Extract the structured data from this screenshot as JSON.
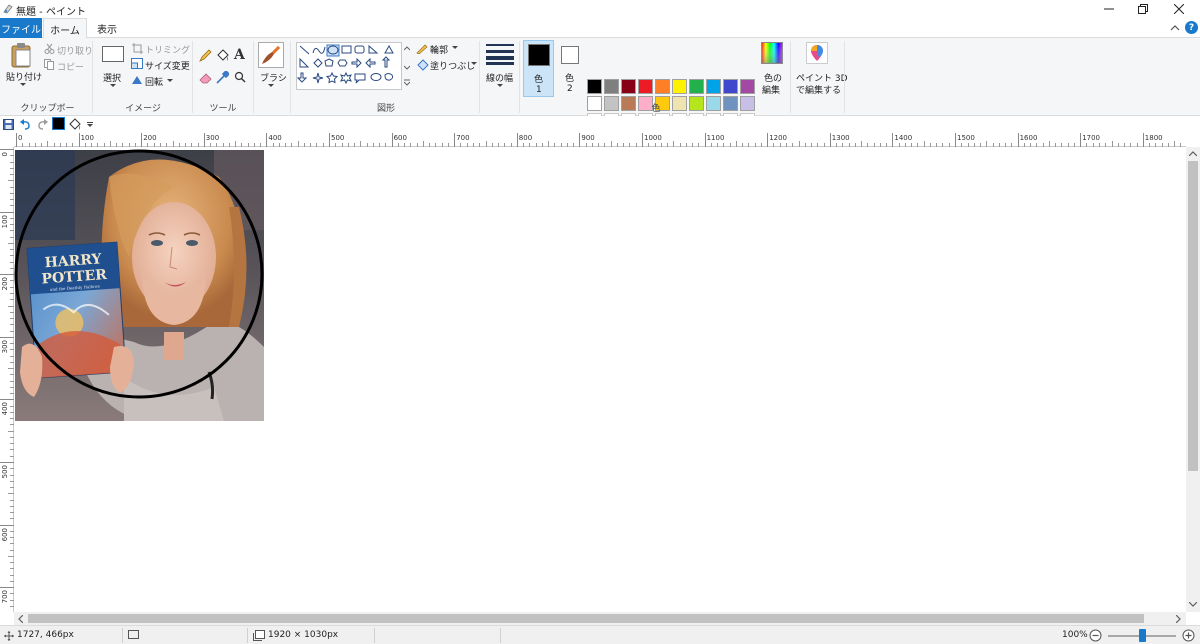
{
  "window": {
    "title": "無題 - ペイント"
  },
  "tabs": {
    "file": "ファイル",
    "home": "ホーム",
    "view": "表示"
  },
  "ribbon": {
    "clipboard": {
      "paste": "貼り付け",
      "cut": "切り取り",
      "copy": "コピー",
      "label": "クリップボード"
    },
    "image": {
      "select": "選択",
      "crop": "トリミング",
      "resize": "サイズ変更",
      "rotate": "回転",
      "label": "イメージ"
    },
    "tools": {
      "label": "ツール"
    },
    "brushes": {
      "label": "ブラシ"
    },
    "shapes": {
      "outline": "輪郭",
      "fill": "塗りつぶし",
      "label": "図形"
    },
    "size": {
      "label": "線の幅"
    },
    "colors": {
      "color1": "色",
      "color1_num": "1",
      "color2": "色",
      "color2_num": "2",
      "edit_colors_l1": "色の",
      "edit_colors_l2": "編集",
      "label": "色",
      "color1_value": "#000000",
      "color2_value": "#ffffff",
      "palette_row1": [
        "#000000",
        "#7f7f7f",
        "#880015",
        "#ed1c24",
        "#ff7f27",
        "#fff200",
        "#22b14c",
        "#00a2e8",
        "#3f48cc",
        "#a349a4"
      ],
      "palette_row2": [
        "#ffffff",
        "#c3c3c3",
        "#b97a57",
        "#ffaec9",
        "#ffc90e",
        "#efe4b0",
        "#b5e61d",
        "#99d9ea",
        "#7092be",
        "#c8bfe7"
      ],
      "palette_row3_count": 10
    },
    "paint3d": {
      "line1": "ペイント 3D",
      "line2": "で編集する"
    }
  },
  "ruler": {
    "h_ticks": [
      "0",
      "100",
      "200",
      "300",
      "400",
      "500",
      "600",
      "700",
      "800",
      "900",
      "1000",
      "1100",
      "1200",
      "1300",
      "1400",
      "1500",
      "1600",
      "1700",
      "1800"
    ],
    "v_ticks": [
      "0",
      "100",
      "200",
      "300",
      "400",
      "500",
      "600",
      "700"
    ]
  },
  "canvas": {
    "photo_book_line1": "HARRY",
    "photo_book_line2": "POTTER",
    "photo_book_line3": "and the Deathly Hallows"
  },
  "status": {
    "cursor_pos": "1727, 466px",
    "canvas_size": "1920 × 1030px",
    "zoom": "100%"
  }
}
